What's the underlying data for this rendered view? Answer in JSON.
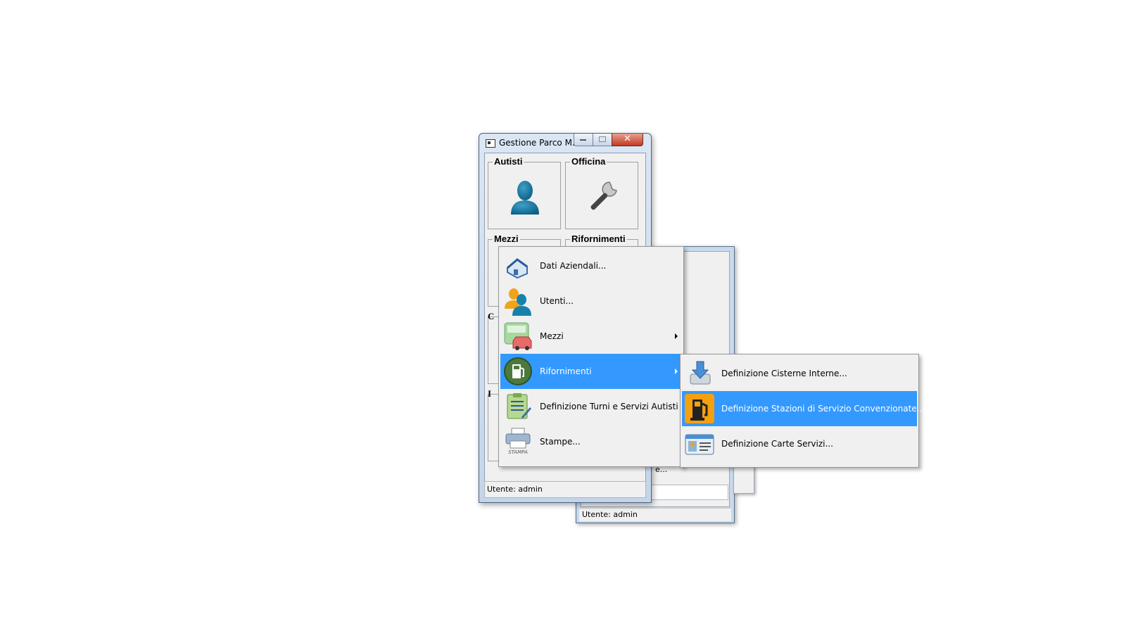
{
  "back_window": {
    "fragment_text": "e...",
    "status": "Utente: admin"
  },
  "main_window": {
    "title": "Gestione Parco M...",
    "close_glyph": "✕",
    "groups": [
      {
        "title": "Autisti",
        "icon": "user-icon"
      },
      {
        "title": "Officina",
        "icon": "wrench-icon"
      },
      {
        "title": "Mezzi"
      },
      {
        "title": "Rifornimenti"
      }
    ],
    "hidden_letters": [
      "C",
      "I"
    ],
    "status": "Utente: admin"
  },
  "context_menu": {
    "items": [
      {
        "label": "Dati Aziendali...",
        "icon": "company-icon"
      },
      {
        "label": "Utenti...",
        "icon": "users-icon"
      },
      {
        "label": "Mezzi",
        "icon": "vehicles-icon",
        "submenu": true
      },
      {
        "label": "Rifornimenti",
        "icon": "fuel-pump-icon",
        "submenu": true,
        "highlighted": true
      },
      {
        "label": "Definizione Turni e Servizi Autisti",
        "icon": "clipboard-icon"
      },
      {
        "label": "Stampe...",
        "icon": "printer-icon",
        "icon_caption": "STAMPA"
      }
    ]
  },
  "submenu": {
    "items": [
      {
        "label": "Definizione Cisterne Interne...",
        "icon": "tank-download-icon"
      },
      {
        "label": "Definizione Stazioni di Servizio Convenzionate...",
        "icon": "gas-station-icon",
        "highlighted": true
      },
      {
        "label": "Definizione Carte Servizi...",
        "icon": "id-card-icon"
      }
    ]
  },
  "colors": {
    "highlight": "#3399ff",
    "menu_bg": "#f0f0f0",
    "window_frame": "#c4d5ea"
  }
}
